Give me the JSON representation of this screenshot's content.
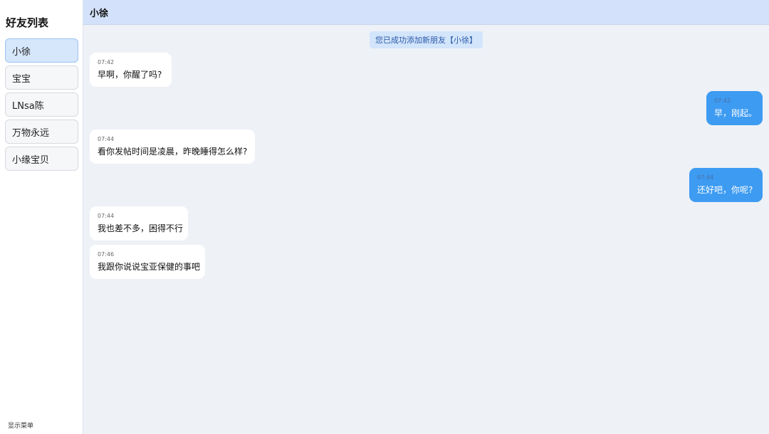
{
  "sidebar": {
    "title": "好友列表",
    "friends": [
      {
        "label": "小徐",
        "active": true
      },
      {
        "label": "宝宝",
        "active": false
      },
      {
        "label": "LNsa陈",
        "active": false
      },
      {
        "label": "万物永远",
        "active": false
      },
      {
        "label": "小缘宝贝",
        "active": false
      }
    ],
    "menu_toggle": "显示菜单"
  },
  "chat": {
    "header_title": "小徐",
    "system_notice": "您已成功添加新朋友【小徐】",
    "messages": [
      {
        "side": "left",
        "time": "07:42",
        "text": "早啊，你醒了吗?"
      },
      {
        "side": "right",
        "time": "07:42",
        "text": "早，刚起。"
      },
      {
        "side": "left",
        "time": "07:44",
        "text": "看你发帖时间是凌晨，昨晚睡得怎么样?"
      },
      {
        "side": "right",
        "time": "07:44",
        "text": "还好吧，你呢?"
      },
      {
        "side": "left",
        "time": "07:44",
        "text": "我也差不多，困得不行"
      },
      {
        "side": "left",
        "time": "07:46",
        "text": "我跟你说说宝亚保健的事吧"
      }
    ]
  },
  "colors": {
    "sidebar_active": "#d6e6fb",
    "header_bg": "#d3e2fa",
    "chat_bg": "#eef1f6",
    "bubble_self": "#3d9bf2",
    "bubble_other": "#ffffff",
    "notice_bg": "#d3e5fb"
  }
}
